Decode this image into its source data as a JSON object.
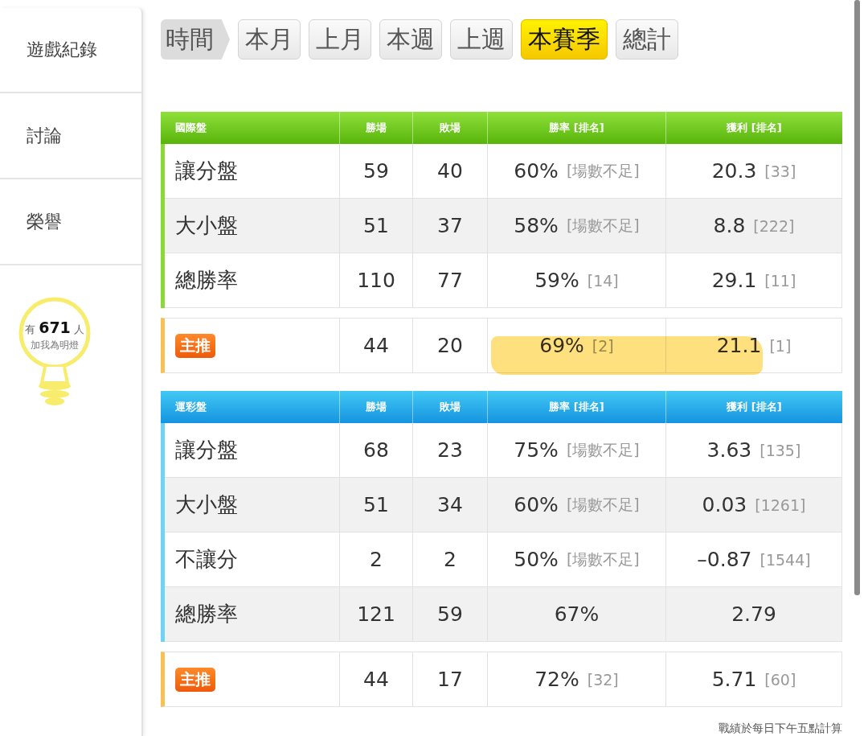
{
  "sidebar": {
    "items": [
      {
        "label": "遊戲紀錄"
      },
      {
        "label": "討論"
      },
      {
        "label": "榮譽"
      }
    ],
    "fans": {
      "prefix": "有",
      "count": "671",
      "suffix": "人",
      "caption": "加我為明燈"
    }
  },
  "period_tabs": {
    "label": "時間",
    "tabs": [
      {
        "label": "本月",
        "selected": false
      },
      {
        "label": "上月",
        "selected": false
      },
      {
        "label": "本週",
        "selected": false
      },
      {
        "label": "上週",
        "selected": false
      },
      {
        "label": "本賽季",
        "selected": true
      },
      {
        "label": "總計",
        "selected": false
      }
    ]
  },
  "tables": [
    {
      "kind": "international",
      "columns": [
        "國際盤",
        "勝場",
        "敗場",
        "勝率 [排名]",
        "獲利 [排名]"
      ],
      "rows": [
        {
          "name": "讓分盤",
          "wins": "59",
          "losses": "40",
          "rate": "60%",
          "rate_rank": "[場數不足]",
          "profit": "20.3",
          "profit_rank": "[33]"
        },
        {
          "name": "大小盤",
          "wins": "51",
          "losses": "37",
          "rate": "58%",
          "rate_rank": "[場數不足]",
          "profit": "8.8",
          "profit_rank": "[222]"
        },
        {
          "name": "總勝率",
          "wins": "110",
          "losses": "77",
          "rate": "59%",
          "rate_rank": "[14]",
          "profit": "29.1",
          "profit_rank": "[11]"
        }
      ],
      "featured": {
        "badge": "主推",
        "wins": "44",
        "losses": "20",
        "rate": "69%",
        "rate_rank": "[2]",
        "profit": "21.1",
        "profit_rank": "[1]",
        "highlighted": true
      }
    },
    {
      "kind": "sports_lottery",
      "columns": [
        "運彩盤",
        "勝場",
        "敗場",
        "勝率 [排名]",
        "獲利 [排名]"
      ],
      "rows": [
        {
          "name": "讓分盤",
          "wins": "68",
          "losses": "23",
          "rate": "75%",
          "rate_rank": "[場數不足]",
          "profit": "3.63",
          "profit_rank": "[135]"
        },
        {
          "name": "大小盤",
          "wins": "51",
          "losses": "34",
          "rate": "60%",
          "rate_rank": "[場數不足]",
          "profit": "0.03",
          "profit_rank": "[1261]"
        },
        {
          "name": "不讓分",
          "wins": "2",
          "losses": "2",
          "rate": "50%",
          "rate_rank": "[場數不足]",
          "profit": "–0.87",
          "profit_rank": "[1544]"
        },
        {
          "name": "總勝率",
          "wins": "121",
          "losses": "59",
          "rate": "67%",
          "profit": "2.79"
        }
      ],
      "featured": {
        "badge": "主推",
        "wins": "44",
        "losses": "17",
        "rate": "72%",
        "rate_rank": "[32]",
        "profit": "5.71",
        "profit_rank": "[60]",
        "highlighted": false
      }
    }
  ],
  "footnote": "戰績於每日下午五點計算"
}
